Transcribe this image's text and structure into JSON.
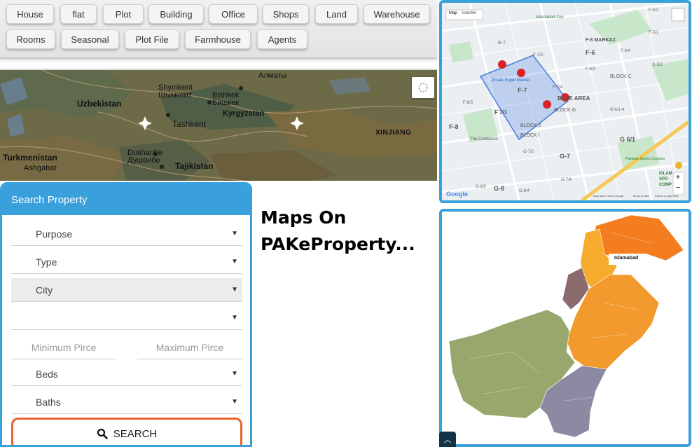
{
  "categories": [
    {
      "label": "House"
    },
    {
      "label": "flat"
    },
    {
      "label": "Plot"
    },
    {
      "label": "Building"
    },
    {
      "label": "Office"
    },
    {
      "label": "Shops"
    },
    {
      "label": "Land"
    },
    {
      "label": "Warehouse"
    },
    {
      "label": "Rooms"
    },
    {
      "label": "Seasonal"
    },
    {
      "label": "Plot File"
    },
    {
      "label": "Farmhouse"
    },
    {
      "label": "Agents"
    }
  ],
  "top_map": {
    "labels": {
      "almaty": "Алматы",
      "shymkent": "Shymkent",
      "shymkent_ru": "Шымкент",
      "bishkek": "Bishkek",
      "bishkek_ru": "Бишкек",
      "uzbekistan": "Uzbekistan",
      "kyrgyzstan": "Kyrgyzstan",
      "tashkent": "Tashkent",
      "xinjiang": "XINJIANG",
      "turkmenistan": "Turkmenistan",
      "ashgabat": "Ashgabat",
      "dushanbe": "Dushanbe",
      "dushanbe_ru": "Душанбе",
      "tajikistan": "Tajikistan"
    }
  },
  "search": {
    "title": "Search Property",
    "purpose": "Purpose",
    "type": "Type",
    "city": "City",
    "area": "",
    "min_price_placeholder": "Minimum Pirce",
    "max_price_placeholder": "Maximum Pirce",
    "beds": "Beds",
    "baths": "Baths",
    "search_label": "SEARCH",
    "search_icon": "search-icon"
  },
  "headline": {
    "line1": "Maps On",
    "line2": "PAKeProperty..."
  },
  "islamabad_map": {
    "map_tab": "Map",
    "satellite_tab": "Satellite",
    "labels": {
      "e7": "E-7",
      "islamabad_zoo": "Islamabad Zoo",
      "f6": "F-6",
      "f6_markaz": "F-6 MARKAZ",
      "f5_2": "F-5/2",
      "f5_1": "F-5/1",
      "f6_3": "F-6/3",
      "f6_4": "F-6/4",
      "f7_3": "F-7/3",
      "block_c": "BLOCK C",
      "g6_2": "G-6/2",
      "jinnah": "Jinnah Super Market",
      "f7": "F-7",
      "f8_3": "F-8/3",
      "f7_1": "F 7/1",
      "f7_4": "F-7/4",
      "blue_area": "BLUE AREA",
      "block_g": "BLOCK G",
      "g6_1_4": "G-6/1-4",
      "block_2": "BLOCK 2",
      "f8": "F-8",
      "centaurus": "The Centaurus",
      "block_i": "BLOCK I",
      "g6_1": "G 6/1",
      "g7": "G-7",
      "g7_2": "G-7/2",
      "sports_complex": "Pakistan Sports Complex",
      "g8_3": "G-8/3",
      "g8": "G-8",
      "g8_4": "G-8/4",
      "g7_4": "G-7/4",
      "islamabad_sports": "ISLAM SPO COMP",
      "google": "Google",
      "map_data": "Map data ©2018 Google",
      "terms": "Terms of Use",
      "report": "Report a map error",
      "zoom_in": "+",
      "zoom_out": "−",
      "fullscreen_icon": "fullscreen-icon",
      "street_view_icon": "pegman-icon"
    },
    "pin_color": "#d9232a",
    "polygon_color": "#4a7be0"
  },
  "pakistan_map": {
    "islamabad_label": "Islamabad",
    "colors": {
      "gilgit": "#f47d20",
      "kpk": "#f7ab2d",
      "fata": "#8c6b6e",
      "punjab": "#f29a2e",
      "balochistan": "#98a86d",
      "sindh": "#8c8aa3"
    }
  },
  "scroll_top": {
    "icon": "chevron-up-icon"
  }
}
